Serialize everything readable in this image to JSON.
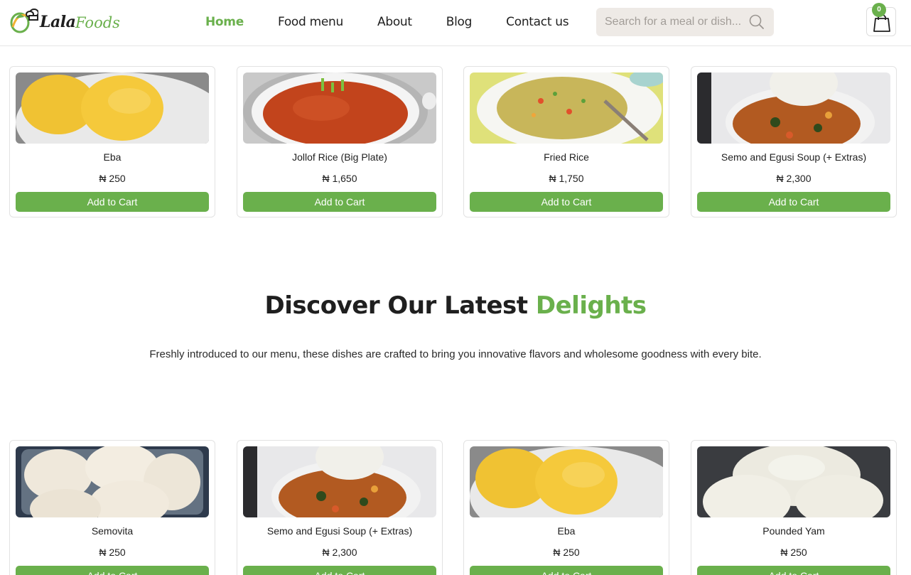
{
  "brand": {
    "name_part1": "Lala",
    "name_part2": "Foods",
    "accent_color": "#6ab04c"
  },
  "nav": [
    {
      "label": "Home",
      "active": true
    },
    {
      "label": "Food menu",
      "active": false
    },
    {
      "label": "About",
      "active": false
    },
    {
      "label": "Blog",
      "active": false
    },
    {
      "label": "Contact us",
      "active": false
    }
  ],
  "search": {
    "placeholder": "Search for a meal or dish...",
    "value": "",
    "icon": "search-icon"
  },
  "cart": {
    "count": "0",
    "icon": "shopping-bag-icon"
  },
  "top_products": [
    {
      "name": "Eba",
      "price": "₦ 250",
      "button": "Add to Cart",
      "image": "eba-photo"
    },
    {
      "name": "Jollof Rice (Big Plate)",
      "price": "₦ 1,650",
      "button": "Add to Cart",
      "image": "jollof-rice-photo"
    },
    {
      "name": "Fried Rice",
      "price": "₦ 1,750",
      "button": "Add to Cart",
      "image": "fried-rice-photo"
    },
    {
      "name": "Semo and Egusi Soup (+ Extras)",
      "price": "₦ 2,300",
      "button": "Add to Cart",
      "image": "semo-egusi-photo"
    }
  ],
  "latest": {
    "title_part1": "Discover Our Latest ",
    "title_part2": "Delights",
    "description": "Freshly introduced to our menu, these dishes are crafted to bring you innovative flavors and wholesome goodness with every bite."
  },
  "latest_products": [
    {
      "name": "Semovita",
      "price": "₦ 250",
      "button": "Add to Cart",
      "image": "semovita-photo"
    },
    {
      "name": "Semo and Egusi Soup (+ Extras)",
      "price": "₦ 2,300",
      "button": "Add to Cart",
      "image": "semo-egusi-photo"
    },
    {
      "name": "Eba",
      "price": "₦ 250",
      "button": "Add to Cart",
      "image": "eba-photo"
    },
    {
      "name": "Pounded Yam",
      "price": "₦ 250",
      "button": "Add to Cart",
      "image": "pounded-yam-photo"
    }
  ]
}
